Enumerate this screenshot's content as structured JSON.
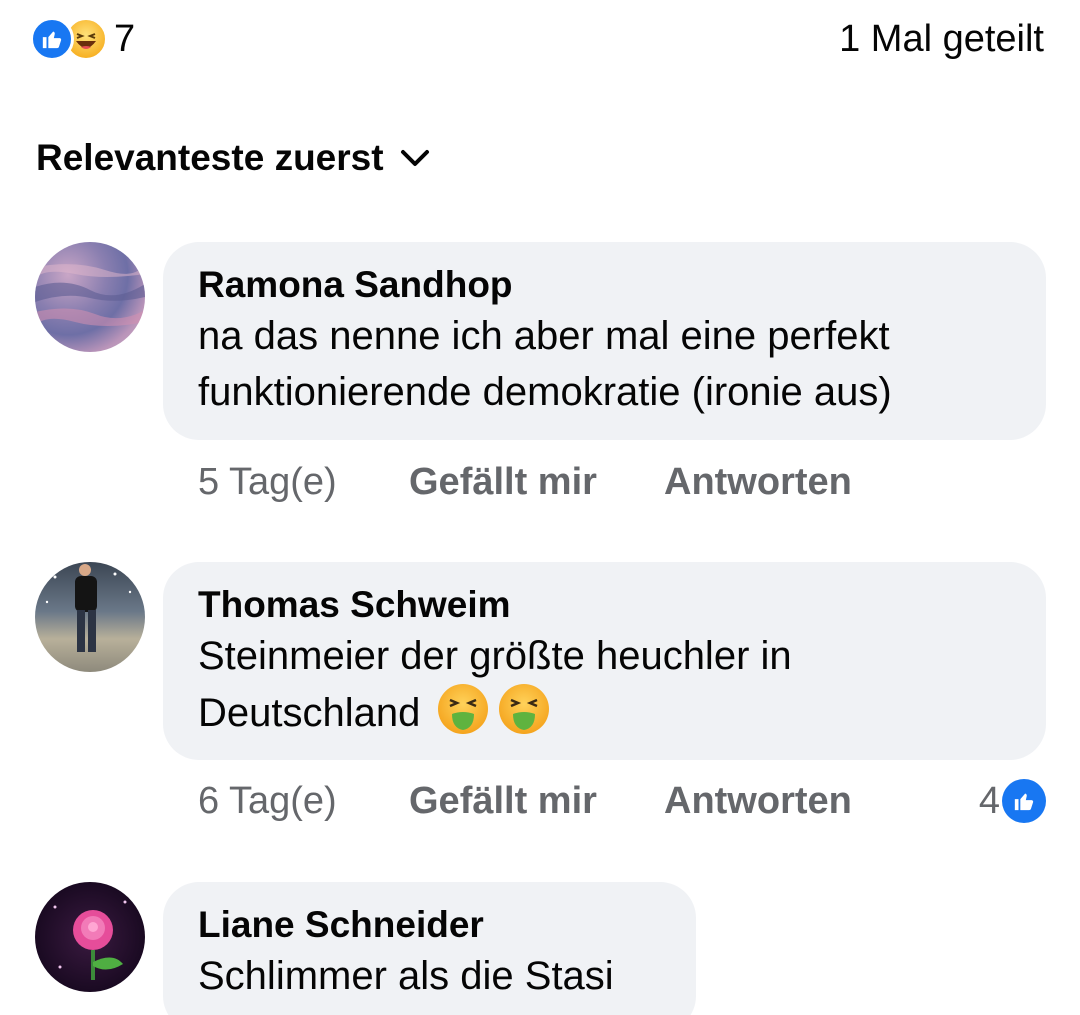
{
  "summary": {
    "reaction_icons": [
      "like-icon",
      "haha-icon"
    ],
    "reaction_count": "7",
    "shares": "1 Mal geteilt"
  },
  "sort": {
    "label": "Relevanteste zuerst",
    "icon": "chevron-down-icon"
  },
  "comments": [
    {
      "author": "Ramona Sandhop",
      "line1": "na das nenne ich aber mal eine perfekt",
      "line2": "funktionierende demokratie (ironie aus)",
      "time": "5 Tag(e)",
      "like_label": "Gefällt mir",
      "reply_label": "Antworten"
    },
    {
      "author": "Thomas Schweim",
      "line1": "Steinmeier der größte heuchler in",
      "line2": "Deutschland",
      "emojis": [
        "nauseated-face-icon",
        "nauseated-face-icon"
      ],
      "time": "6 Tag(e)",
      "like_label": "Gefällt mir",
      "reply_label": "Antworten",
      "like_count": "4"
    },
    {
      "author": "Liane Schneider",
      "line1": "Schlimmer als die Stasi"
    }
  ],
  "colors": {
    "brand_blue": "#1877f2",
    "bubble_bg": "#f0f2f5",
    "secondary_text": "#65676b"
  }
}
